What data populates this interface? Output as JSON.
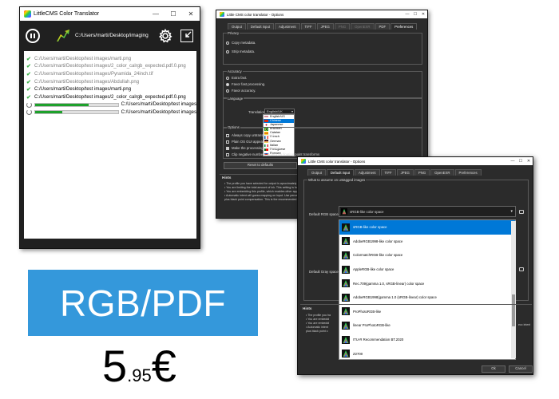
{
  "main_window": {
    "title": "LittleCMS Color Translator",
    "controls": {
      "minimize": "—",
      "maximize": "☐",
      "close": "✕"
    },
    "output_folder": "C:/Users/marti/Desktop/imaging",
    "files": [
      {
        "status": "done",
        "path": "C:/Users/marti/Desktop/test images/marti.png",
        "dim": true
      },
      {
        "status": "done",
        "path": "C:/Users/marti/Desktop/test images/2_color_calrgb_expected.pdf.0.png",
        "dim": true
      },
      {
        "status": "done",
        "path": "C:/Users/marti/Desktop/test images/Pyramida_24inch.tif",
        "dim": true
      },
      {
        "status": "done",
        "path": "C:/Users/marti/Desktop/test images/Abdullah.png",
        "dim": true
      },
      {
        "status": "done",
        "path": "C:/Users/marti/Desktop/test images/marti.png",
        "dim": false
      },
      {
        "status": "done",
        "path": "C:/Users/marti/Desktop/test images/2_color_calrgb_expected.pdf.0.png",
        "dim": false
      },
      {
        "status": "progress",
        "path": "C:/Users/marti/Desktop/test images",
        "progress": 0.65
      },
      {
        "status": "progress",
        "path": "C:/Users/marti/Desktop/test images",
        "progress": 0.33
      }
    ]
  },
  "options_window_1": {
    "title": "Little CMS color translator - Options",
    "tabs": [
      {
        "label": "Output",
        "disabled": false,
        "active": false
      },
      {
        "label": "Default input",
        "disabled": false,
        "active": false
      },
      {
        "label": "Adjustment",
        "disabled": false,
        "active": false
      },
      {
        "label": "TIFF",
        "disabled": false,
        "active": false
      },
      {
        "label": "JPEG",
        "disabled": false,
        "active": false
      },
      {
        "label": "PNG",
        "disabled": true,
        "active": false
      },
      {
        "label": "OpenEXR",
        "disabled": true,
        "active": false
      },
      {
        "label": "PDF",
        "disabled": false,
        "active": false
      },
      {
        "label": "Preferences",
        "disabled": false,
        "active": true
      }
    ],
    "privacy": {
      "label": "Privacy",
      "options": [
        {
          "label": "Copy metadata.",
          "on": false
        },
        {
          "label": "Strip metadata.",
          "on": false
        }
      ]
    },
    "accuracy": {
      "label": "Accuracy",
      "options": [
        {
          "label": "Extra fast.",
          "on": false
        },
        {
          "label": "Favor fast processing.",
          "on": true
        },
        {
          "label": "Favor accuracy.",
          "on": false
        }
      ]
    },
    "language": {
      "label": "Language",
      "field_label": "Translation",
      "selected": "English/UK",
      "items": [
        {
          "label": "English/US",
          "flag": "us"
        },
        {
          "label": "Chinese",
          "flag": "cn",
          "selected": true
        },
        {
          "label": "Japanese",
          "flag": "jp"
        },
        {
          "label": "Brazilian",
          "flag": "br"
        },
        {
          "label": "Catalan",
          "flag": "ct"
        },
        {
          "label": "French",
          "flag": "fr"
        },
        {
          "label": "German",
          "flag": "de"
        },
        {
          "label": "Italian",
          "flag": "it"
        },
        {
          "label": "Portuguese",
          "flag": "pt"
        },
        {
          "label": "Russian",
          "flag": "ru"
        }
      ]
    },
    "options_group": {
      "label": "Options",
      "checks": [
        {
          "label": "Always copy untransformed",
          "on": false
        },
        {
          "label": "Plain OS GUI appearance",
          "on": false
        },
        {
          "label": "Make the processing sequential",
          "on": true
        },
        {
          "label": "Clip negative numbers to zero on floating point transforms",
          "on": false
        }
      ]
    },
    "reset_label": "Reset to defaults",
    "hints_title": "Hints",
    "hints": [
      "• The profile you have selected for output is aproximately sRGB.",
      "• You are limiting the total amount of ink. This setting is for printers only.",
      "• You are embedding this profile, which enables other applications to recognize it.",
      "• Automatic intent will guess mapping on input. Use perceptual for photos.",
      "  plus black point compensation. This is the recommended setting."
    ]
  },
  "options_window_2": {
    "title": "Little CMS color translator - Options",
    "tabs": [
      {
        "label": "Output",
        "active": false
      },
      {
        "label": "Default input",
        "active": true
      },
      {
        "label": "Adjustment",
        "active": false
      },
      {
        "label": "TIFF",
        "active": false
      },
      {
        "label": "JPEG",
        "active": false
      },
      {
        "label": "PNG",
        "active": false
      },
      {
        "label": "OpenEXR",
        "active": false
      },
      {
        "label": "Preferences",
        "active": false
      }
    ],
    "group_label": "What to assume on untagged images",
    "rgb_label": "Default RGB space",
    "gray_label": "Default Gray space",
    "rgb_value": "sRGB-like color space",
    "profiles": [
      {
        "label": "sRGB-like color space",
        "selected": true
      },
      {
        "label": "AdobeRGB1998-like color space"
      },
      {
        "label": "ColormatchRGB-like color space"
      },
      {
        "label": "AppleRGB-like color space"
      },
      {
        "label": "Rec.709(gamma 1.0, sRGB-linear) color space"
      },
      {
        "label": "AdobeRGB1998(gamma 1.0 (sRGB-linear) color space"
      },
      {
        "label": "ProPhotoRGB-like"
      },
      {
        "label": "linear ProPhotoRGB-like"
      },
      {
        "label": "ITU-R Recommendation BT.2020"
      },
      {
        "label": "Z2700"
      }
    ],
    "hints_title": "Hints",
    "hints": [
      "• The profile you ha",
      "• You are embeddi",
      "• You are embeddi",
      "• Automatic intent",
      "  plus black point c"
    ],
    "hint_tail": "ecc intent",
    "ok_label": "Ok",
    "cancel_label": "Cancel"
  },
  "promo": {
    "product_name": "RGB/PDF",
    "price_integer": "5",
    "price_decimal": ".95",
    "currency": "€",
    "banner_color": "#3498db"
  }
}
